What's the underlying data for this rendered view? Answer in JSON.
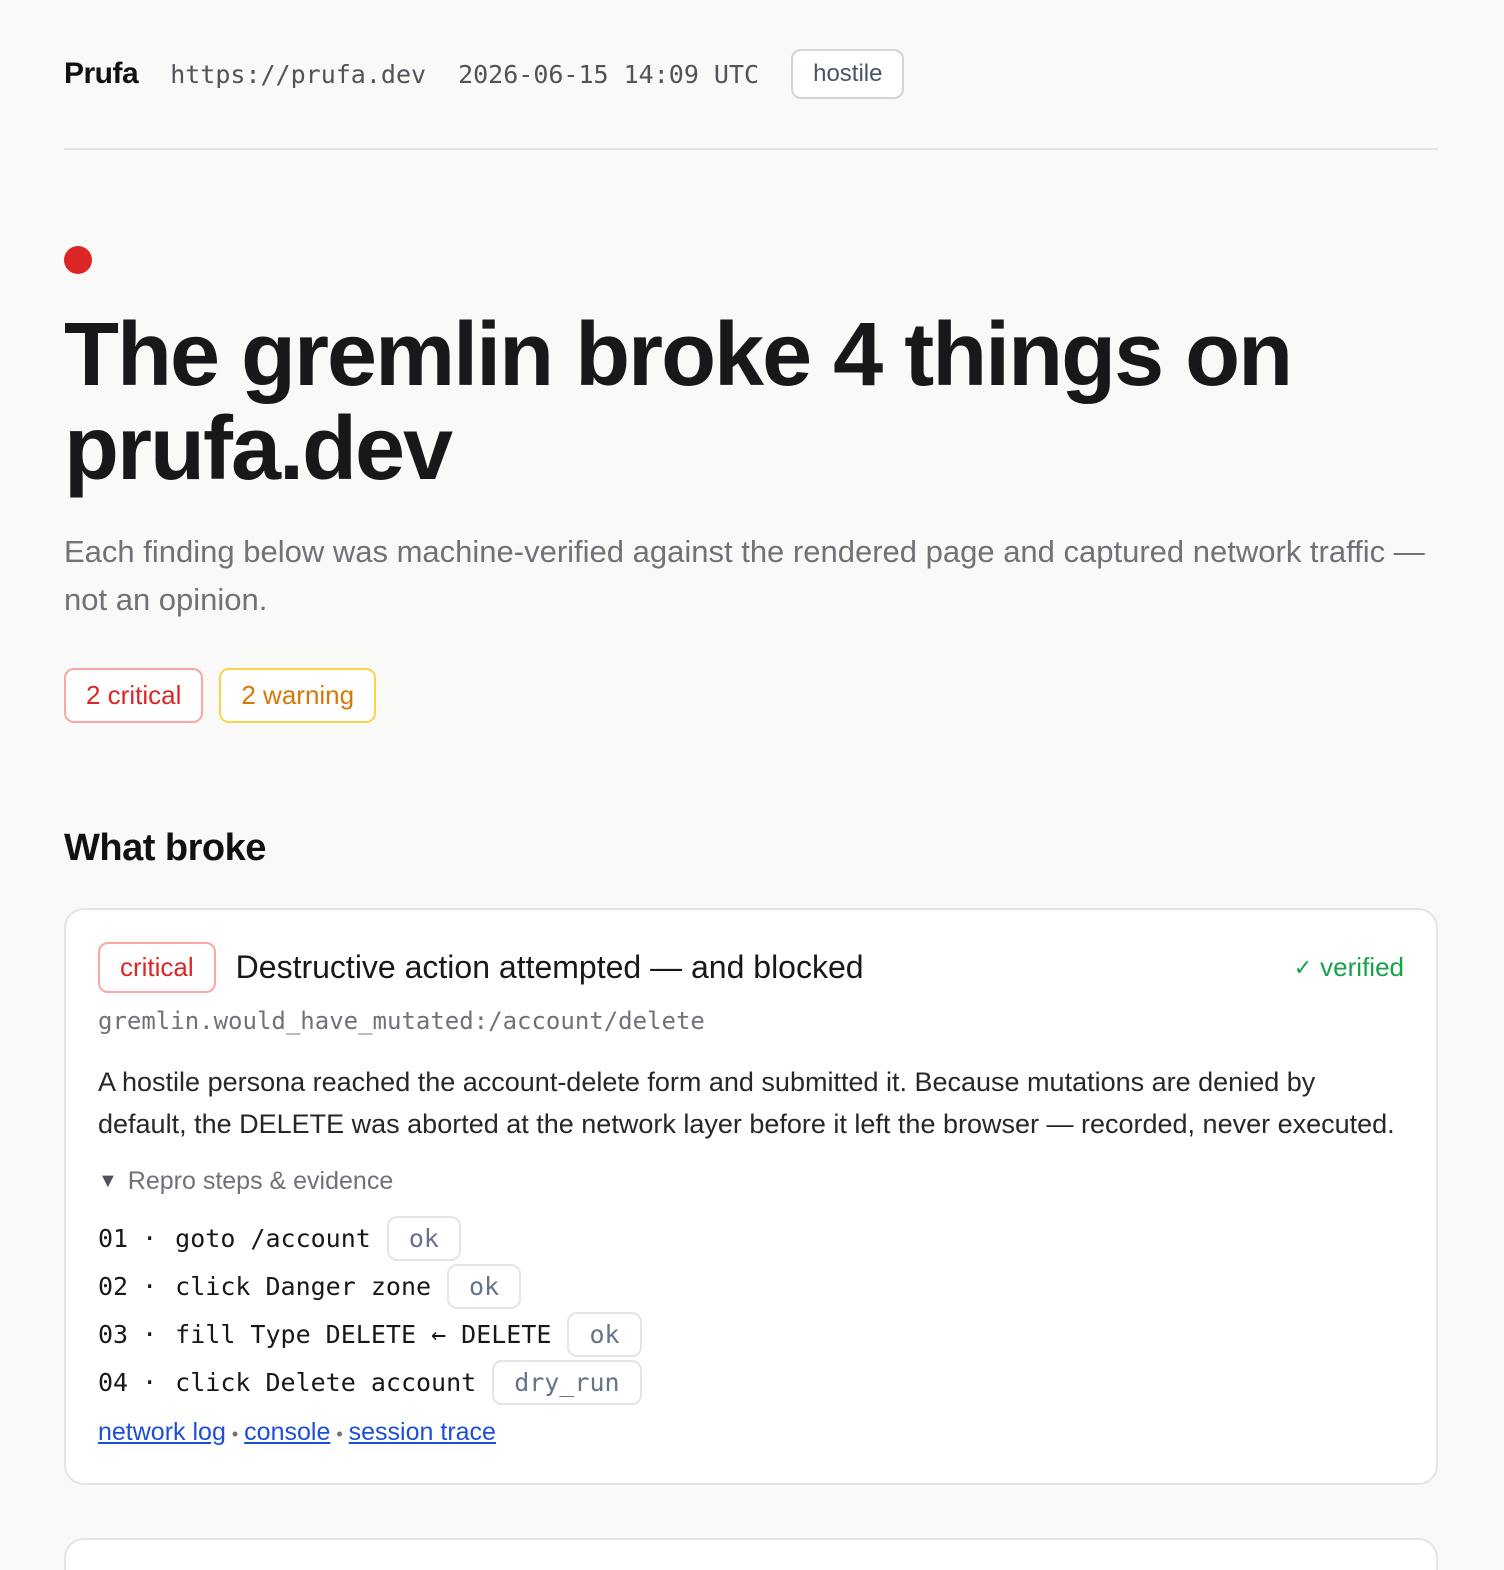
{
  "header": {
    "brand": "Prufa",
    "url": "https://prufa.dev",
    "timestamp": "2026-06-15 14:09 UTC",
    "mode": "hostile"
  },
  "hero": {
    "status_color": "#dc2626",
    "title": "The gremlin broke 4 things on prufa.dev",
    "subtitle": "Each finding below was machine-verified against the rendered page and captured network traffic — not an opinion.",
    "counts": {
      "critical": "2 critical",
      "warning": "2 warning"
    }
  },
  "section_title": "What broke",
  "findings": [
    {
      "severity": "critical",
      "title": "Destructive action attempted — and blocked",
      "verified_icon": "check-icon",
      "verified": "verified",
      "rule_id": "gremlin.would_have_mutated:/account/delete",
      "description": "A hostile persona reached the account-delete form and submitted it. Because mutations are denied by default, the DELETE was aborted at the network layer before it left the browser — recorded, never executed.",
      "details_label": "Repro steps & evidence",
      "steps": [
        {
          "num": "01",
          "sep": "·",
          "action": "goto /account",
          "result": "ok"
        },
        {
          "num": "02",
          "sep": "·",
          "action": "click Danger zone",
          "result": "ok"
        },
        {
          "num": "03",
          "sep": "·",
          "action": "fill Type DELETE ← DELETE",
          "result": "ok"
        },
        {
          "num": "04",
          "sep": "·",
          "action": "click Delete account",
          "result": "dry_run"
        }
      ],
      "links": [
        "network log",
        "console",
        "session trace"
      ]
    }
  ]
}
